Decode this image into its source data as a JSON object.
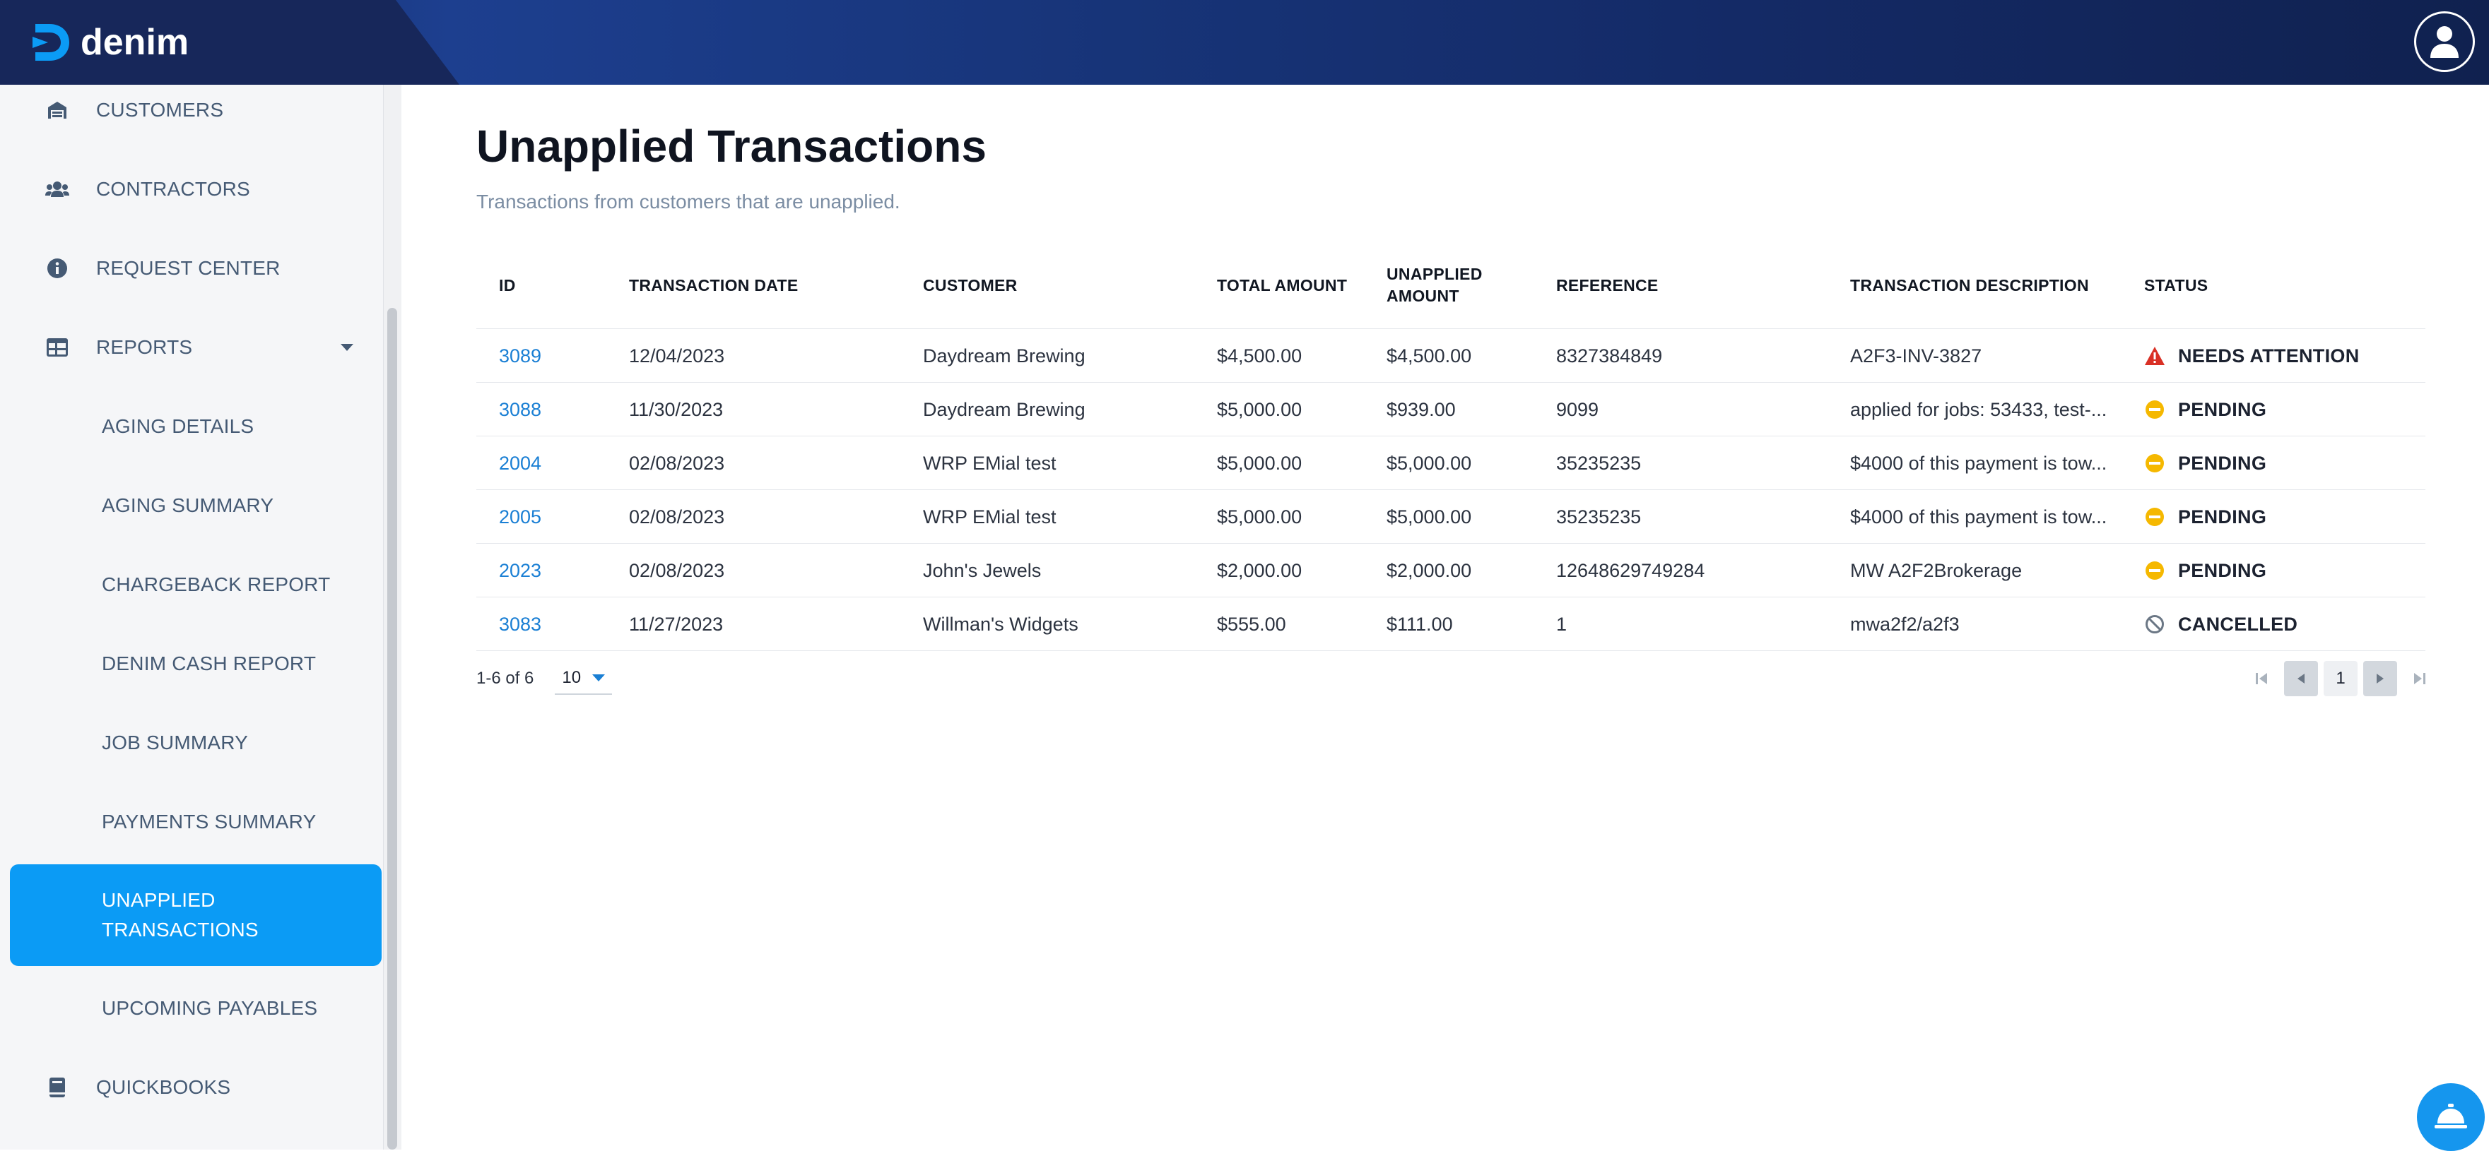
{
  "app": {
    "logo_text": "denim",
    "accent": "#0b9bf5",
    "header_color": "#17275a"
  },
  "sidebar": {
    "items": [
      {
        "label": "CUSTOMERS",
        "icon": "warehouse-icon"
      },
      {
        "label": "CONTRACTORS",
        "icon": "users-icon"
      },
      {
        "label": "REQUEST CENTER",
        "icon": "info-icon"
      },
      {
        "label": "REPORTS",
        "icon": "table-icon",
        "expanded": true
      },
      {
        "label": "AGING DETAILS"
      },
      {
        "label": "AGING SUMMARY"
      },
      {
        "label": "CHARGEBACK REPORT"
      },
      {
        "label": "DENIM CASH REPORT"
      },
      {
        "label": "JOB SUMMARY"
      },
      {
        "label": "PAYMENTS SUMMARY"
      },
      {
        "label_line1": "UNAPPLIED",
        "label_line2": "TRANSACTIONS",
        "active": true
      },
      {
        "label": "UPCOMING PAYABLES"
      },
      {
        "label": "QUICKBOOKS",
        "icon": "book-icon"
      }
    ]
  },
  "page": {
    "title": "Unapplied Transactions",
    "subtitle": "Transactions from customers that are unapplied."
  },
  "table": {
    "headers": {
      "id": "ID",
      "date": "TRANSACTION DATE",
      "customer": "CUSTOMER",
      "total": "TOTAL AMOUNT",
      "unapplied_1": "UNAPPLIED",
      "unapplied_2": "AMOUNT",
      "reference": "REFERENCE",
      "description": "TRANSACTION DESCRIPTION",
      "status": "STATUS"
    },
    "rows": [
      {
        "id": "3089",
        "date": "12/04/2023",
        "customer": "Daydream Brewing",
        "total": "$4,500.00",
        "unapplied": "$4,500.00",
        "reference": "8327384849",
        "description": "A2F3-INV-3827",
        "status": "NEEDS ATTENTION",
        "status_icon": "warning-icon"
      },
      {
        "id": "3088",
        "date": "11/30/2023",
        "customer": "Daydream Brewing",
        "total": "$5,000.00",
        "unapplied": "$939.00",
        "reference": "9099",
        "description": "applied for jobs: 53433, test-...",
        "status": "PENDING",
        "status_icon": "pending-icon"
      },
      {
        "id": "2004",
        "date": "02/08/2023",
        "customer": "WRP EMial test",
        "total": "$5,000.00",
        "unapplied": "$5,000.00",
        "reference": "35235235",
        "description": "$4000 of this payment is tow...",
        "status": "PENDING",
        "status_icon": "pending-icon"
      },
      {
        "id": "2005",
        "date": "02/08/2023",
        "customer": "WRP EMial test",
        "total": "$5,000.00",
        "unapplied": "$5,000.00",
        "reference": "35235235",
        "description": "$4000 of this payment is tow...",
        "status": "PENDING",
        "status_icon": "pending-icon"
      },
      {
        "id": "2023",
        "date": "02/08/2023",
        "customer": "John's Jewels",
        "total": "$2,000.00",
        "unapplied": "$2,000.00",
        "reference": "12648629749284",
        "description": "MW A2F2Brokerage",
        "status": "PENDING",
        "status_icon": "pending-icon"
      },
      {
        "id": "3083",
        "date": "11/27/2023",
        "customer": "Willman's Widgets",
        "total": "$555.00",
        "unapplied": "$111.00",
        "reference": "1",
        "description": "mwa2f2/a2f3",
        "status": "CANCELLED",
        "status_icon": "cancelled-icon"
      }
    ]
  },
  "pagination": {
    "range": "1-6 of 6",
    "page_size": "10",
    "current_page": "1"
  },
  "colors": {
    "link": "#1a7fd4",
    "warning": "#d93025",
    "pending": "#f5b800",
    "cancelled": "#6b7785"
  }
}
